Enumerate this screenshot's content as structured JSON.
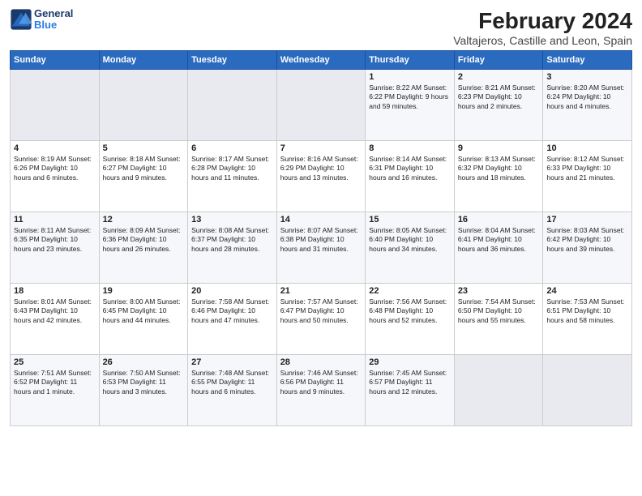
{
  "logo": {
    "line1": "General",
    "line2": "Blue"
  },
  "title": "February 2024",
  "location": "Valtajeros, Castille and Leon, Spain",
  "headers": [
    "Sunday",
    "Monday",
    "Tuesday",
    "Wednesday",
    "Thursday",
    "Friday",
    "Saturday"
  ],
  "weeks": [
    [
      {
        "day": "",
        "info": ""
      },
      {
        "day": "",
        "info": ""
      },
      {
        "day": "",
        "info": ""
      },
      {
        "day": "",
        "info": ""
      },
      {
        "day": "1",
        "info": "Sunrise: 8:22 AM\nSunset: 6:22 PM\nDaylight: 9 hours\nand 59 minutes."
      },
      {
        "day": "2",
        "info": "Sunrise: 8:21 AM\nSunset: 6:23 PM\nDaylight: 10 hours\nand 2 minutes."
      },
      {
        "day": "3",
        "info": "Sunrise: 8:20 AM\nSunset: 6:24 PM\nDaylight: 10 hours\nand 4 minutes."
      }
    ],
    [
      {
        "day": "4",
        "info": "Sunrise: 8:19 AM\nSunset: 6:26 PM\nDaylight: 10 hours\nand 6 minutes."
      },
      {
        "day": "5",
        "info": "Sunrise: 8:18 AM\nSunset: 6:27 PM\nDaylight: 10 hours\nand 9 minutes."
      },
      {
        "day": "6",
        "info": "Sunrise: 8:17 AM\nSunset: 6:28 PM\nDaylight: 10 hours\nand 11 minutes."
      },
      {
        "day": "7",
        "info": "Sunrise: 8:16 AM\nSunset: 6:29 PM\nDaylight: 10 hours\nand 13 minutes."
      },
      {
        "day": "8",
        "info": "Sunrise: 8:14 AM\nSunset: 6:31 PM\nDaylight: 10 hours\nand 16 minutes."
      },
      {
        "day": "9",
        "info": "Sunrise: 8:13 AM\nSunset: 6:32 PM\nDaylight: 10 hours\nand 18 minutes."
      },
      {
        "day": "10",
        "info": "Sunrise: 8:12 AM\nSunset: 6:33 PM\nDaylight: 10 hours\nand 21 minutes."
      }
    ],
    [
      {
        "day": "11",
        "info": "Sunrise: 8:11 AM\nSunset: 6:35 PM\nDaylight: 10 hours\nand 23 minutes."
      },
      {
        "day": "12",
        "info": "Sunrise: 8:09 AM\nSunset: 6:36 PM\nDaylight: 10 hours\nand 26 minutes."
      },
      {
        "day": "13",
        "info": "Sunrise: 8:08 AM\nSunset: 6:37 PM\nDaylight: 10 hours\nand 28 minutes."
      },
      {
        "day": "14",
        "info": "Sunrise: 8:07 AM\nSunset: 6:38 PM\nDaylight: 10 hours\nand 31 minutes."
      },
      {
        "day": "15",
        "info": "Sunrise: 8:05 AM\nSunset: 6:40 PM\nDaylight: 10 hours\nand 34 minutes."
      },
      {
        "day": "16",
        "info": "Sunrise: 8:04 AM\nSunset: 6:41 PM\nDaylight: 10 hours\nand 36 minutes."
      },
      {
        "day": "17",
        "info": "Sunrise: 8:03 AM\nSunset: 6:42 PM\nDaylight: 10 hours\nand 39 minutes."
      }
    ],
    [
      {
        "day": "18",
        "info": "Sunrise: 8:01 AM\nSunset: 6:43 PM\nDaylight: 10 hours\nand 42 minutes."
      },
      {
        "day": "19",
        "info": "Sunrise: 8:00 AM\nSunset: 6:45 PM\nDaylight: 10 hours\nand 44 minutes."
      },
      {
        "day": "20",
        "info": "Sunrise: 7:58 AM\nSunset: 6:46 PM\nDaylight: 10 hours\nand 47 minutes."
      },
      {
        "day": "21",
        "info": "Sunrise: 7:57 AM\nSunset: 6:47 PM\nDaylight: 10 hours\nand 50 minutes."
      },
      {
        "day": "22",
        "info": "Sunrise: 7:56 AM\nSunset: 6:48 PM\nDaylight: 10 hours\nand 52 minutes."
      },
      {
        "day": "23",
        "info": "Sunrise: 7:54 AM\nSunset: 6:50 PM\nDaylight: 10 hours\nand 55 minutes."
      },
      {
        "day": "24",
        "info": "Sunrise: 7:53 AM\nSunset: 6:51 PM\nDaylight: 10 hours\nand 58 minutes."
      }
    ],
    [
      {
        "day": "25",
        "info": "Sunrise: 7:51 AM\nSunset: 6:52 PM\nDaylight: 11 hours\nand 1 minute."
      },
      {
        "day": "26",
        "info": "Sunrise: 7:50 AM\nSunset: 6:53 PM\nDaylight: 11 hours\nand 3 minutes."
      },
      {
        "day": "27",
        "info": "Sunrise: 7:48 AM\nSunset: 6:55 PM\nDaylight: 11 hours\nand 6 minutes."
      },
      {
        "day": "28",
        "info": "Sunrise: 7:46 AM\nSunset: 6:56 PM\nDaylight: 11 hours\nand 9 minutes."
      },
      {
        "day": "29",
        "info": "Sunrise: 7:45 AM\nSunset: 6:57 PM\nDaylight: 11 hours\nand 12 minutes."
      },
      {
        "day": "",
        "info": ""
      },
      {
        "day": "",
        "info": ""
      }
    ]
  ]
}
